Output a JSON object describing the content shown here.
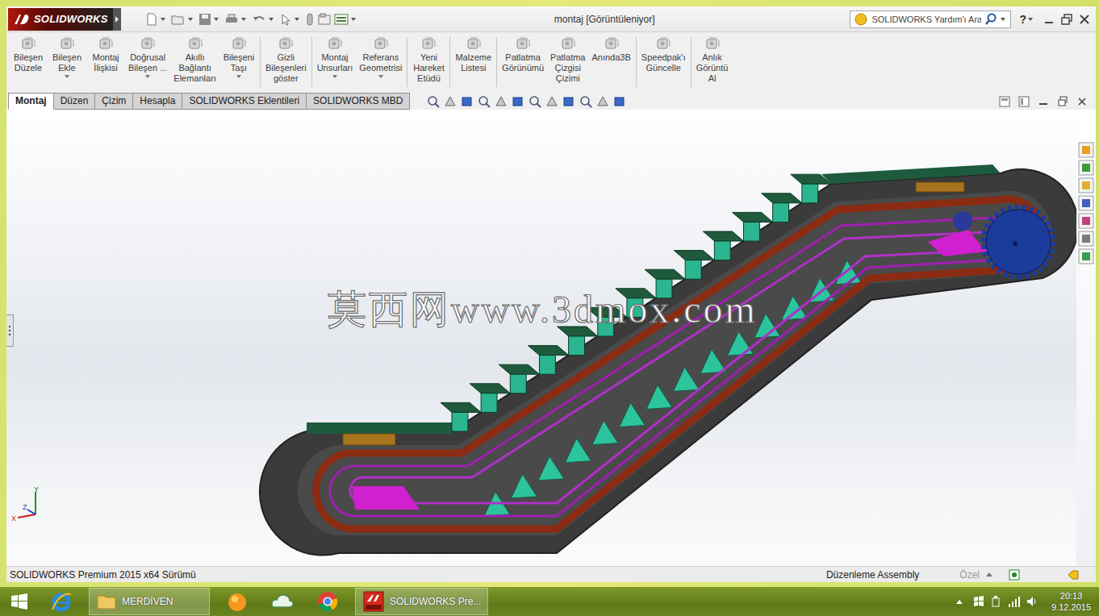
{
  "window": {
    "title": "montaj [Görüntüleniyor]"
  },
  "logo": {
    "text": "SOLIDWORKS"
  },
  "search": {
    "placeholder": "SOLIDWORKS Yardım'ı Ara"
  },
  "help": "?",
  "ribbon": {
    "groups": [
      [
        {
          "lines": [
            "Bileşen",
            "Düzele"
          ],
          "dropdown": false
        },
        {
          "lines": [
            "Bileşen",
            "Ekle"
          ],
          "dropdown": true
        },
        {
          "lines": [
            "Montaj",
            "İlişkisi"
          ],
          "dropdown": false
        },
        {
          "lines": [
            "Doğrusal",
            "Bileşen ..."
          ],
          "dropdown": true
        },
        {
          "lines": [
            "Akıllı",
            "Bağlantı",
            "Elemanları"
          ],
          "dropdown": false
        },
        {
          "lines": [
            "Bileşeni",
            "Taşı"
          ],
          "dropdown": true
        }
      ],
      [
        {
          "lines": [
            "Gizli",
            "Bileşenleri",
            "göster"
          ],
          "dropdown": false
        }
      ],
      [
        {
          "lines": [
            "Montaj",
            "Unsurları"
          ],
          "dropdown": true
        },
        {
          "lines": [
            "Referans",
            "Geometrisi"
          ],
          "dropdown": true
        }
      ],
      [
        {
          "lines": [
            "Yeni",
            "Hareket",
            "Etüdü"
          ],
          "dropdown": false
        }
      ],
      [
        {
          "lines": [
            "Malzeme",
            "Listesi"
          ],
          "dropdown": false
        }
      ],
      [
        {
          "lines": [
            "Patlatma",
            "Görünümü"
          ],
          "dropdown": false
        },
        {
          "lines": [
            "Patlatma",
            "Çizgisi",
            "Çizimi"
          ],
          "dropdown": false
        },
        {
          "lines": [
            "Anında3B"
          ],
          "dropdown": false
        }
      ],
      [
        {
          "lines": [
            "Speedpak'ı",
            "Güncelle"
          ],
          "dropdown": false
        }
      ],
      [
        {
          "lines": [
            "Anlık",
            "Görüntü",
            "Al"
          ],
          "dropdown": false
        }
      ]
    ]
  },
  "tabs": [
    {
      "label": "Montaj",
      "selected": true
    },
    {
      "label": "Düzen",
      "selected": false
    },
    {
      "label": "Çizim",
      "selected": false
    },
    {
      "label": "Hesapla",
      "selected": false
    },
    {
      "label": "SOLIDWORKS Eklentileri",
      "selected": false
    },
    {
      "label": "SOLIDWORKS MBD",
      "selected": false
    }
  ],
  "watermark": "莫西网www.3dmox.com",
  "triad": {
    "x": "X",
    "y": "Y",
    "z": "Z"
  },
  "status_bar": {
    "version": "SOLIDWORKS Premium 2015 x64 Sürümü",
    "mode": "Düzenleme Assembly",
    "units": "Özel",
    "units_disabled": true
  },
  "taskbar": {
    "apps": [
      {
        "kind": "ie"
      },
      {
        "kind": "folder",
        "label": "MERDİVEN"
      },
      {
        "kind": "orange"
      },
      {
        "kind": "cloud"
      },
      {
        "kind": "chrome"
      },
      {
        "kind": "solidworks",
        "label": "SOLIDWORKS Pre..."
      }
    ],
    "clock": {
      "time": "20:13",
      "date": "9.12.2015"
    }
  }
}
